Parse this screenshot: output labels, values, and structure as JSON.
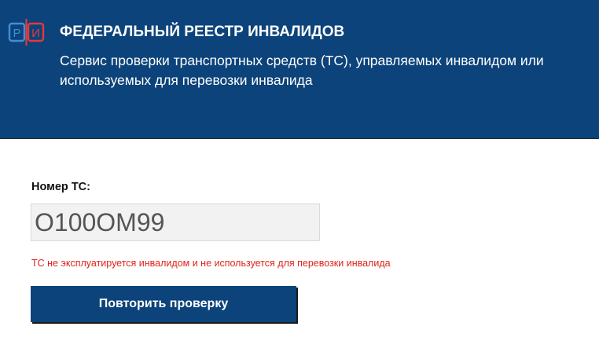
{
  "header": {
    "logo_letters": [
      "Р",
      "И"
    ],
    "title": "ФЕДЕРАЛЬНЫЙ РЕЕСТР ИНВАЛИДОВ",
    "subtitle": "Сервис проверки транспортных средств (ТС), управляемых инвалидом или используемых для перевозки инвалида"
  },
  "form": {
    "vehicle_label": "Номер ТС:",
    "vehicle_value": "О100ОМ99",
    "result_message": "ТС не эксплуатируется инвалидом и не используется для перевозки инвалида",
    "retry_button_label": "Повторить проверку"
  },
  "colors": {
    "brand_blue": "#0c437a",
    "error_red": "#e0231a",
    "logo_blue": "#3f8fd9",
    "logo_red": "#e23a3a"
  }
}
